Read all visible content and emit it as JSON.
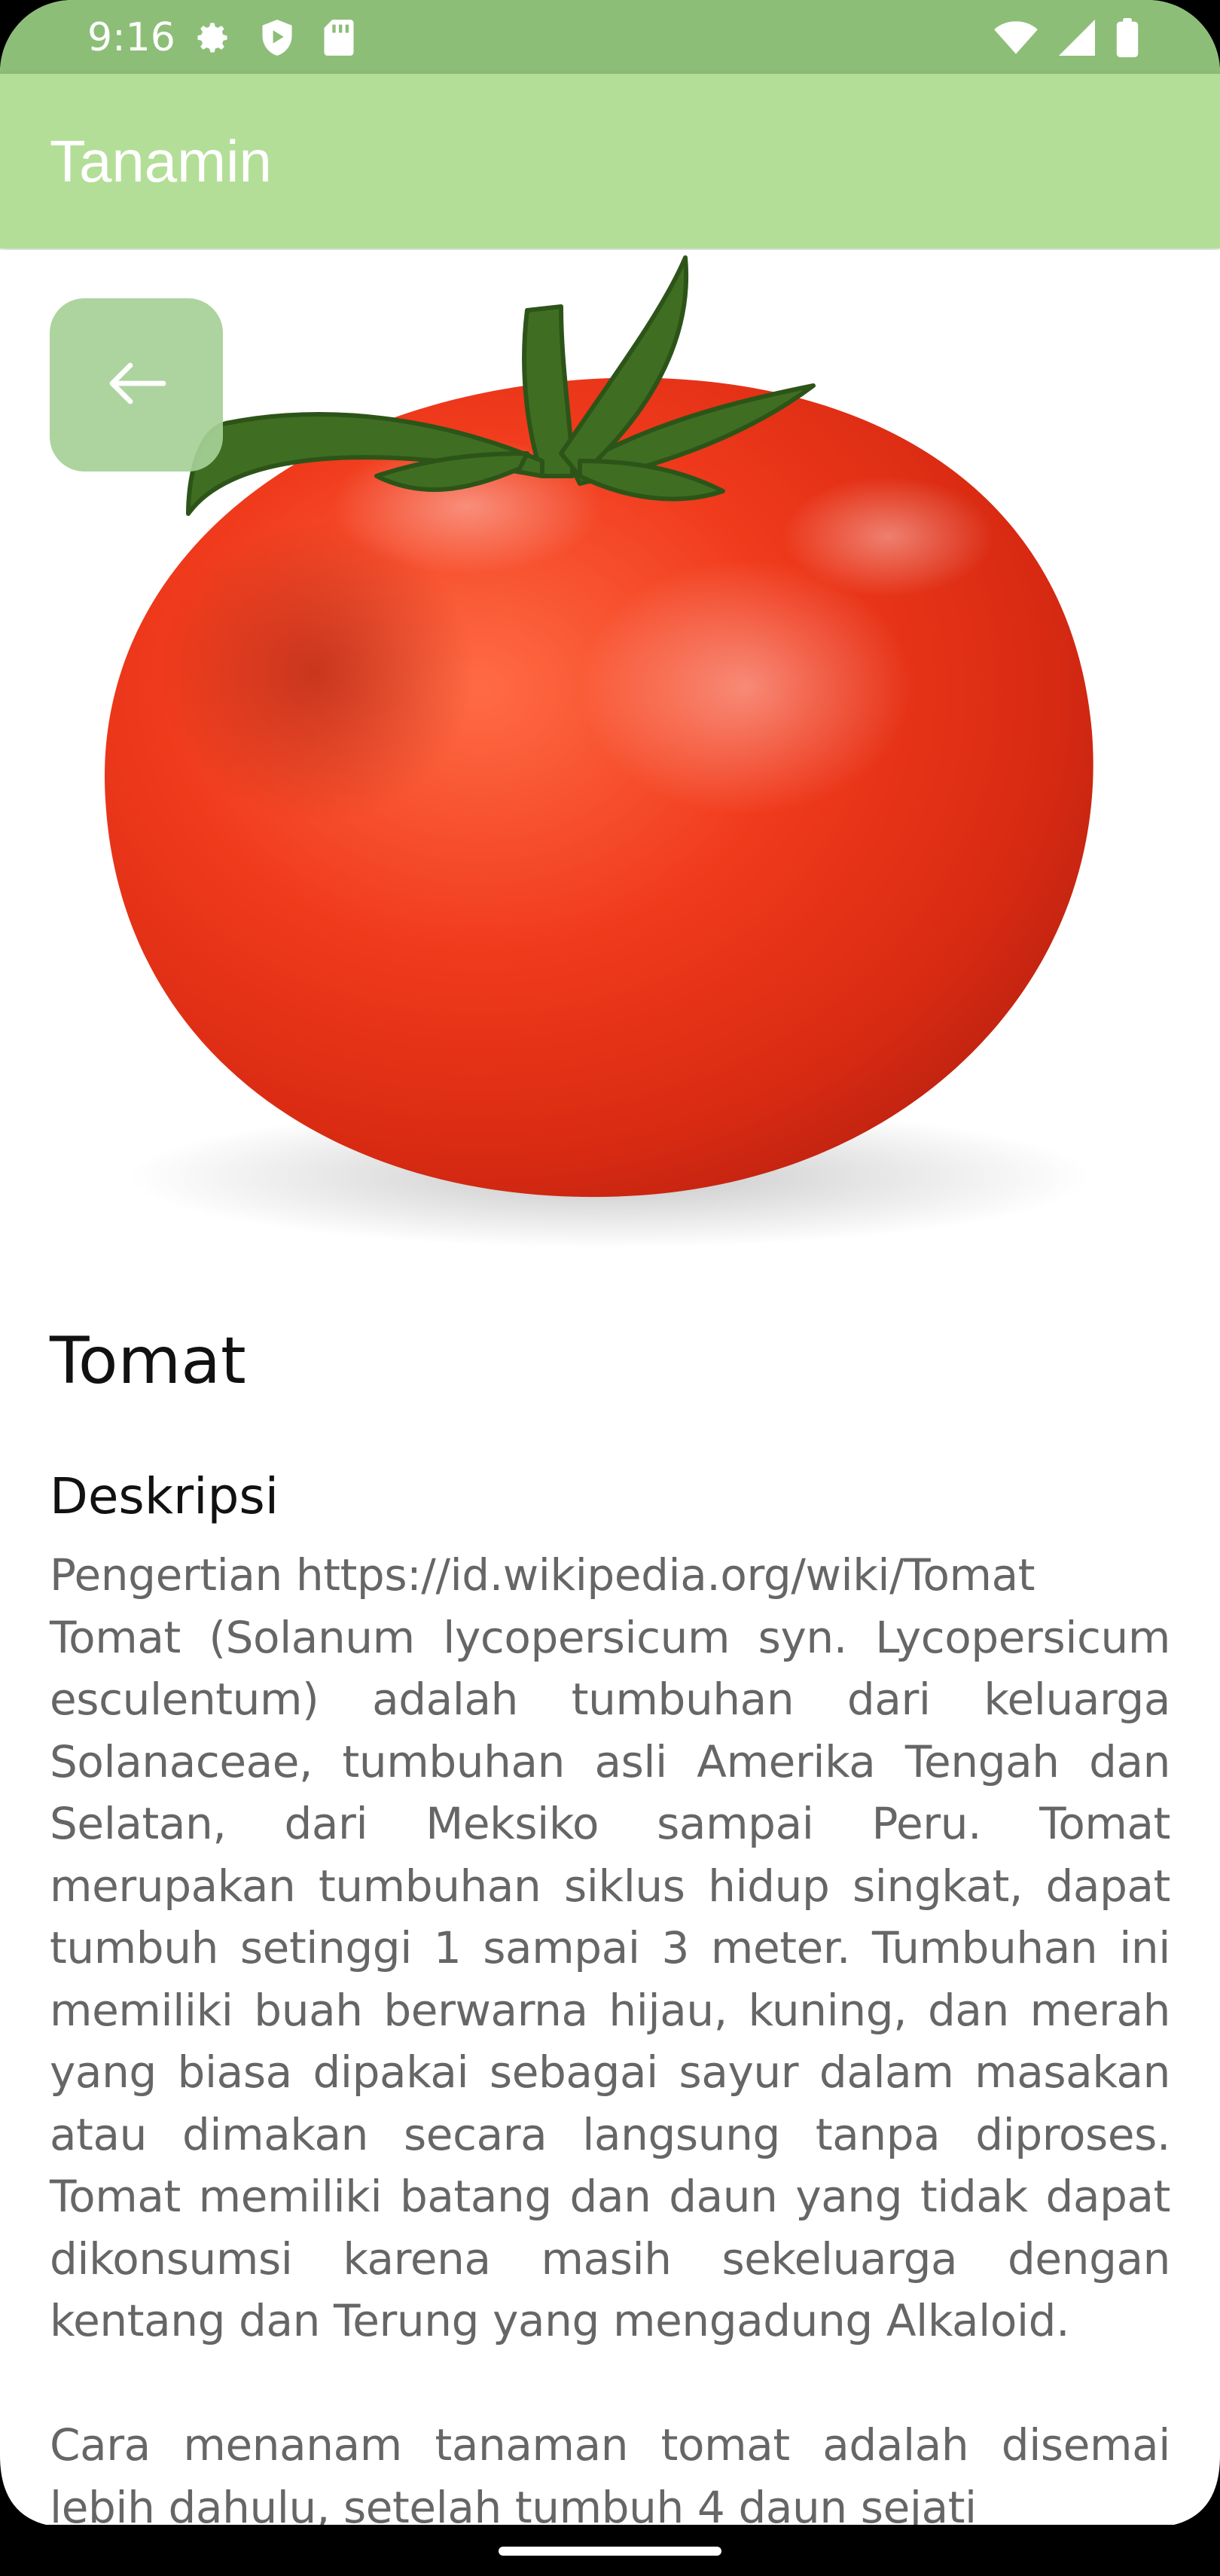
{
  "status_bar": {
    "time": "9:16",
    "left_icons": [
      "gear-icon",
      "shield-play-icon",
      "sd-card-icon"
    ],
    "right_icons": [
      "wifi-icon",
      "signal-icon",
      "battery-icon"
    ],
    "color": "#8dbe78"
  },
  "app_bar": {
    "title": "Tanamin",
    "color": "#b3de97"
  },
  "back_button": {
    "icon": "arrow-left-icon"
  },
  "plant": {
    "name": "Tomat",
    "section_title": "Deskripsi",
    "description": "Pengertian  https://id.wikipedia.org/wiki/Tomat\nTomat (Solanum lycopersicum syn. Lycopersicum esculentum) adalah tumbuhan dari keluarga Solanaceae, tumbuhan asli Amerika Tengah dan Selatan, dari Meksiko sampai Peru. Tomat merupakan tumbuhan siklus hidup singkat, dapat tumbuh setinggi 1 sampai 3 meter. Tumbuhan ini memiliki buah berwarna hijau, kuning, dan merah yang biasa dipakai sebagai sayur dalam masakan atau dimakan secara langsung tanpa diproses. Tomat memiliki batang dan daun yang tidak dapat dikonsumsi karena masih sekeluarga dengan kentang dan Terung yang mengadung Alkaloid.\n\nCara menanam tanaman tomat adalah disemai lebih dahulu, setelah tumbuh 4 daun sejati"
  }
}
